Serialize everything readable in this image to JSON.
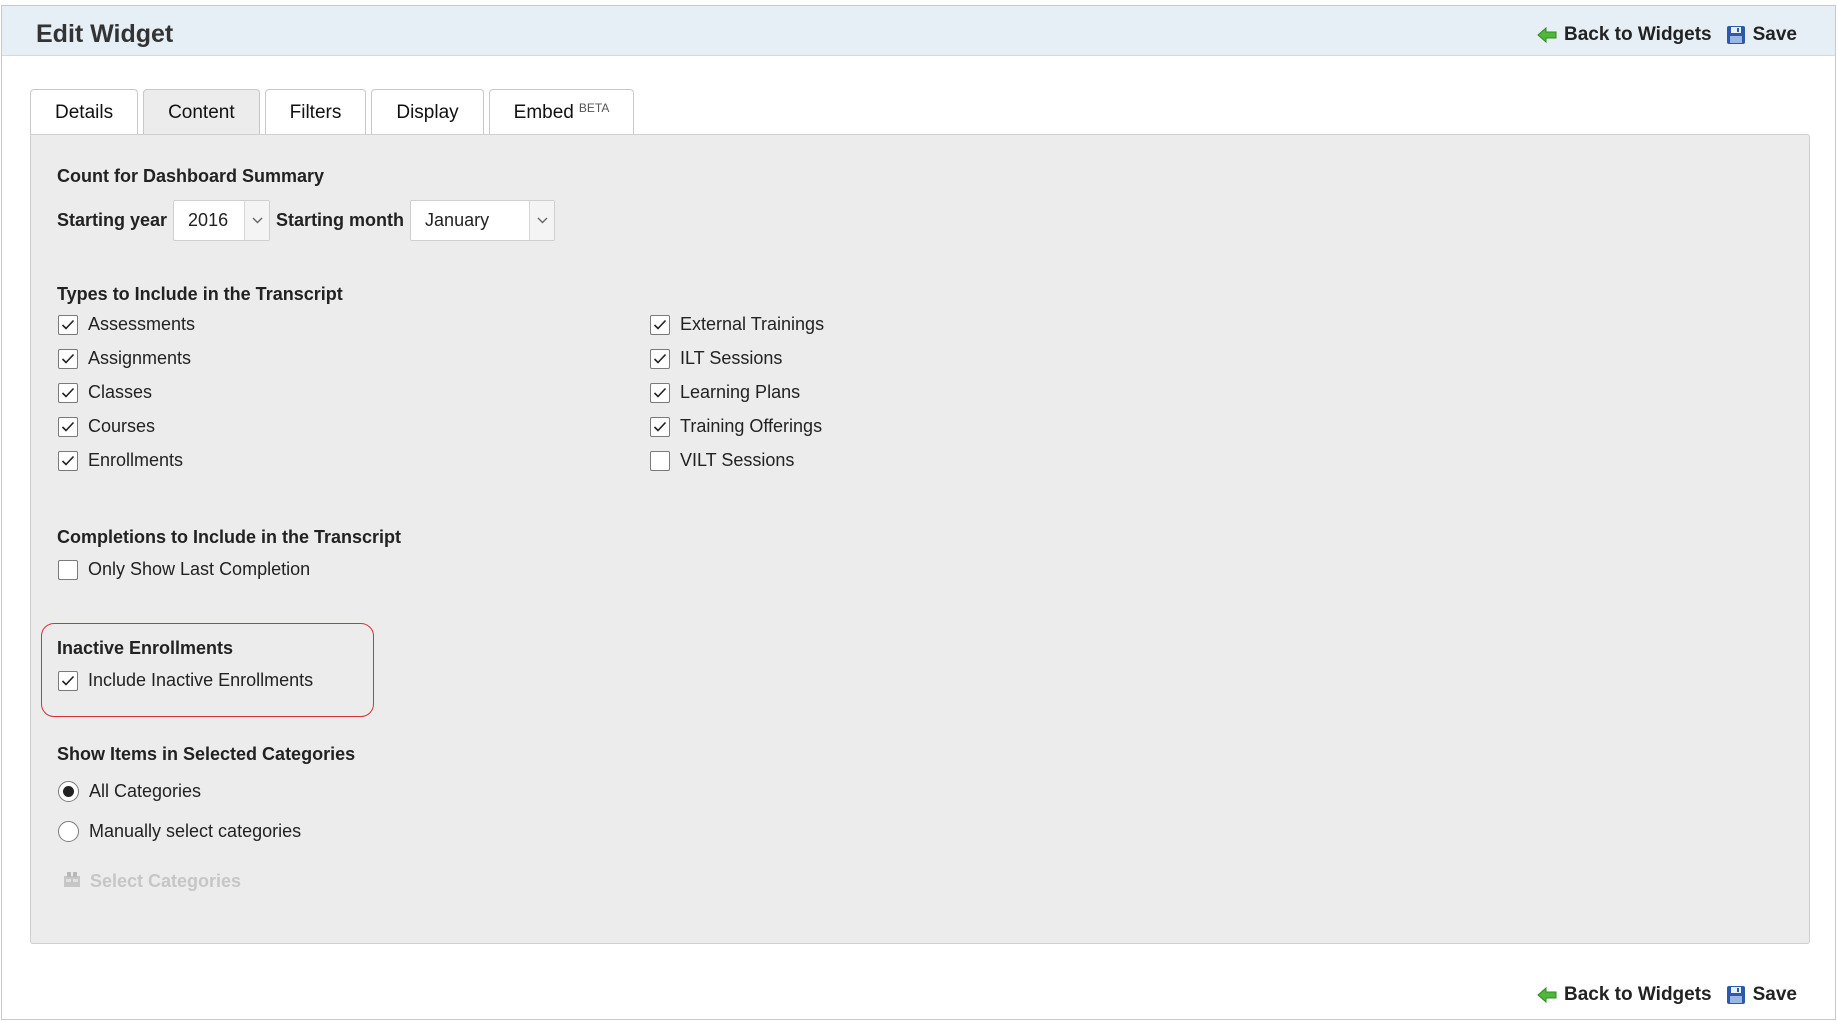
{
  "header": {
    "title": "Edit Widget"
  },
  "actions": {
    "back_label": "Back to Widgets",
    "save_label": "Save"
  },
  "tabs": [
    {
      "label": "Details",
      "active": false
    },
    {
      "label": "Content",
      "active": true
    },
    {
      "label": "Filters",
      "active": false
    },
    {
      "label": "Display",
      "active": false
    },
    {
      "label": "Embed",
      "badge": "BETA",
      "active": false
    }
  ],
  "dashboard_summary": {
    "title": "Count for Dashboard Summary",
    "year_label": "Starting year",
    "year_value": "2016",
    "month_label": "Starting month",
    "month_value": "January"
  },
  "types": {
    "title": "Types to Include in the Transcript",
    "left": [
      {
        "label": "Assessments",
        "checked": true
      },
      {
        "label": "Assignments",
        "checked": true
      },
      {
        "label": "Classes",
        "checked": true
      },
      {
        "label": "Courses",
        "checked": true
      },
      {
        "label": "Enrollments",
        "checked": true
      }
    ],
    "right": [
      {
        "label": "External Trainings",
        "checked": true
      },
      {
        "label": "ILT Sessions",
        "checked": true
      },
      {
        "label": "Learning Plans",
        "checked": true
      },
      {
        "label": "Training Offerings",
        "checked": true
      },
      {
        "label": "VILT Sessions",
        "checked": false
      }
    ]
  },
  "completions": {
    "title": "Completions to Include in the Transcript",
    "option": {
      "label": "Only Show Last Completion",
      "checked": false
    }
  },
  "inactive": {
    "title": "Inactive Enrollments",
    "option": {
      "label": "Include Inactive Enrollments",
      "checked": true
    }
  },
  "categories": {
    "title": "Show Items in Selected Categories",
    "options": [
      {
        "label": "All Categories",
        "selected": true
      },
      {
        "label": "Manually select categories",
        "selected": false
      }
    ],
    "select_label": "Select Categories"
  },
  "colors": {
    "header_bg": "#e6eef6",
    "panel_bg": "#ececec",
    "highlight_border": "#d6303b",
    "back_arrow": "#4fb83a",
    "save_icon": "#2a5aa8"
  }
}
